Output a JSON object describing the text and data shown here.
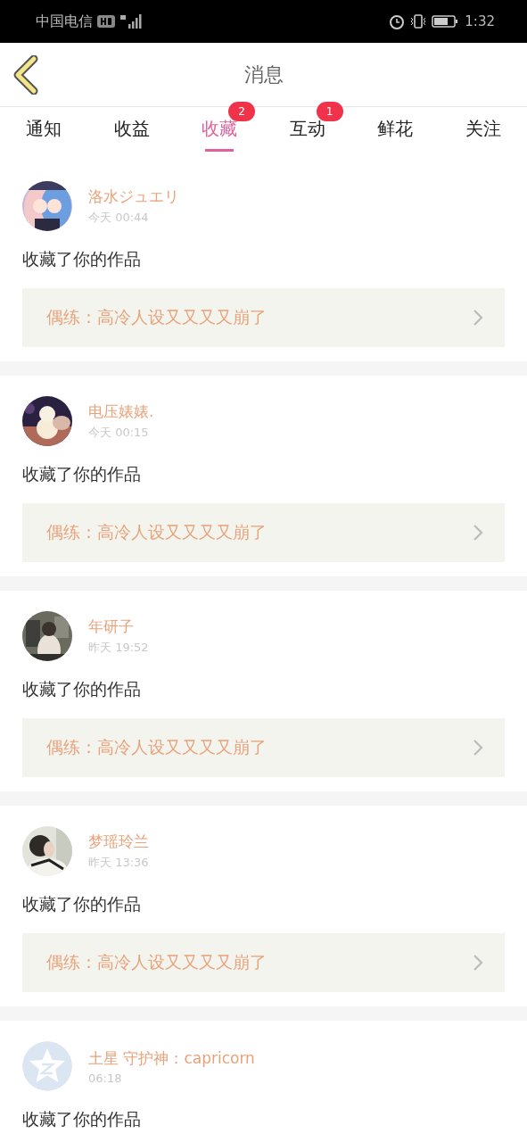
{
  "status_bar": {
    "carrier": "中国电信",
    "time": "1:32"
  },
  "header": {
    "title": "消息"
  },
  "tabs": [
    {
      "label": "通知",
      "selected": false
    },
    {
      "label": "收益",
      "selected": false
    },
    {
      "label": "收藏",
      "selected": true,
      "badge": "2"
    },
    {
      "label": "互动",
      "selected": false,
      "badge": "1"
    },
    {
      "label": "鲜花",
      "selected": false
    },
    {
      "label": "关注",
      "selected": false
    }
  ],
  "messages": [
    {
      "user": "洛水ジュエリ",
      "time": "今天 00:44",
      "action": "收藏了你的作品",
      "work": "偶练：高冷人设又又又又崩了"
    },
    {
      "user": "电压婊婊.",
      "time": "今天 00:15",
      "action": "收藏了你的作品",
      "work": "偶练：高冷人设又又又又崩了"
    },
    {
      "user": "年研子",
      "time": "昨天 19:52",
      "action": "收藏了你的作品",
      "work": "偶练：高冷人设又又又又崩了"
    },
    {
      "user": "梦瑶玲兰",
      "time": "昨天 13:36",
      "action": "收藏了你的作品",
      "work": "偶练：高冷人设又又又又崩了"
    },
    {
      "avatar": {
        "kind": "default"
      },
      "user": "土星 守护神：capricorn",
      "time": "06:18",
      "action": "收藏了你的作品"
    }
  ]
}
